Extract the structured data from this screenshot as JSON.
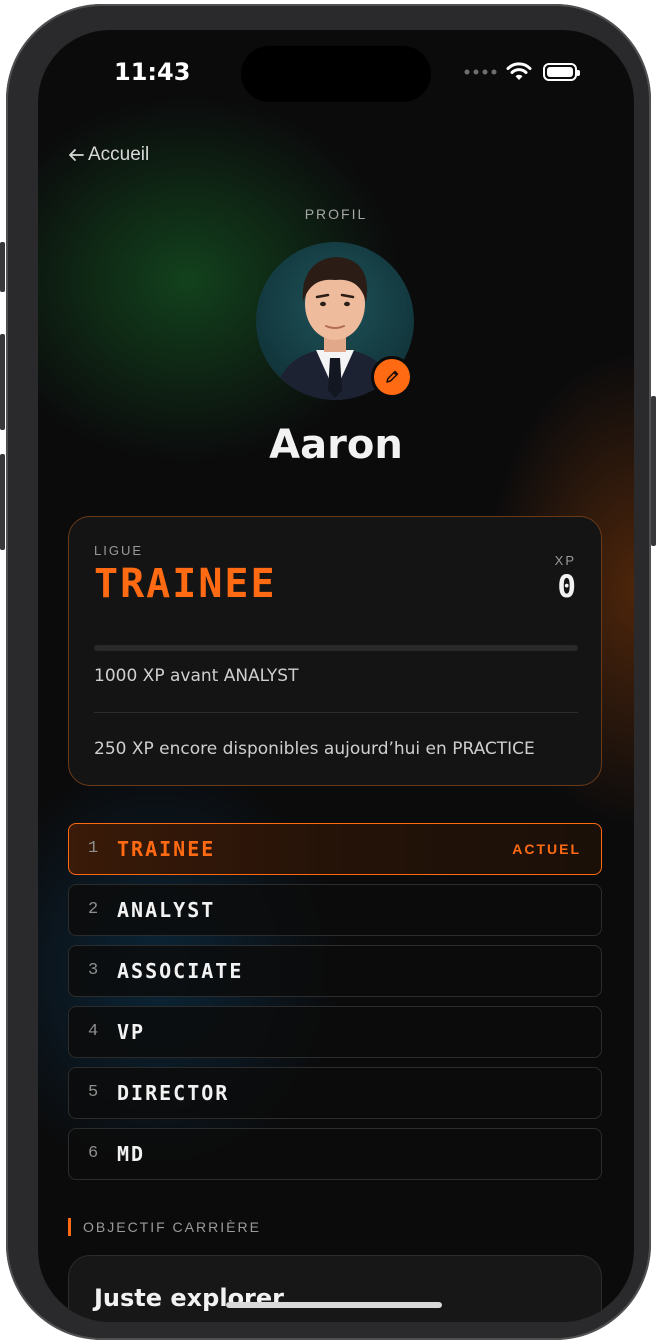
{
  "status_bar": {
    "time": "11:43"
  },
  "nav": {
    "back_label": "Accueil"
  },
  "profile": {
    "kicker": "PROFIL",
    "name": "Aaron"
  },
  "league_card": {
    "league_label": "LIGUE",
    "league_name": "TRAINEE",
    "xp_label": "XP",
    "xp_value": "0",
    "progress_fraction": 0,
    "next_league_text": "1000 XP avant ANALYST",
    "daily_remaining_text": "250 XP encore disponibles aujourd’hui en PRACTICE"
  },
  "ranks": [
    {
      "num": "1",
      "name": "TRAINEE",
      "badge": "ACTUEL"
    },
    {
      "num": "2",
      "name": "ANALYST"
    },
    {
      "num": "3",
      "name": "ASSOCIATE"
    },
    {
      "num": "4",
      "name": "VP"
    },
    {
      "num": "5",
      "name": "DIRECTOR"
    },
    {
      "num": "6",
      "name": "MD"
    }
  ],
  "career_goal": {
    "label": "OBJECTIF CARRIÈRE",
    "value": "Juste explorer"
  },
  "colors": {
    "accent": "#ff6a13",
    "background": "#0b0b0c",
    "card": "#141414"
  },
  "icons": [
    "back-arrow-icon",
    "pencil-icon",
    "signal-icon",
    "wifi-icon",
    "battery-icon"
  ]
}
